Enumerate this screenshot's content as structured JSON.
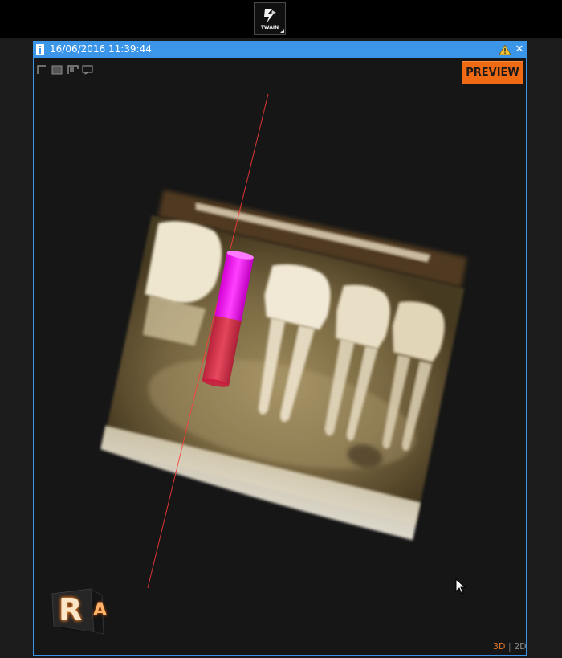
{
  "toolbar": {
    "twain_label": "TWAIN",
    "twain_icon": "twain-logo-icon"
  },
  "viewer": {
    "title": "16/06/2016 11:39:44",
    "accent_color": "#3b96e9",
    "icons": [
      "info-icon",
      "warning-icon",
      "close-icon"
    ],
    "layout_icons": [
      "layout-single-icon",
      "layout-double-icon",
      "layout-triple-icon",
      "layout-quad-icon"
    ],
    "preview_label": "PREVIEW",
    "preview_color": "#f06a14",
    "orientation_cube": {
      "front_letter": "R",
      "side_letter": "A"
    },
    "mode_toggle": {
      "active": "3D",
      "separator": "|",
      "inactive": "2D"
    },
    "render": {
      "subject": "3D CBCT volume rendering of mandible with planned implant",
      "implant_colors": [
        "#ff1aff",
        "#e8264a"
      ],
      "axis_line_color": "#ff3a3a"
    }
  }
}
